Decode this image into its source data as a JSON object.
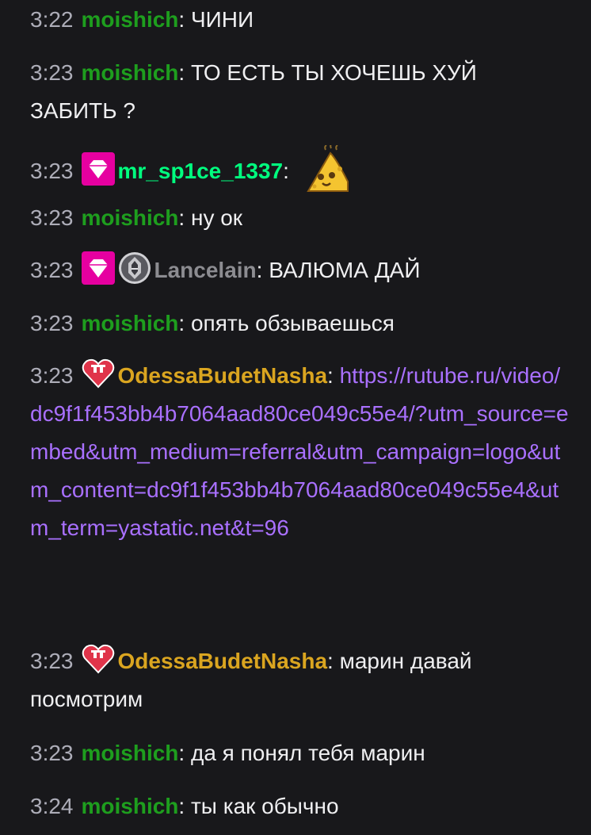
{
  "colors": {
    "background": "#18181b",
    "timestamp": "#adadb8",
    "text": "#efeff1",
    "link": "#a970ff",
    "moishich": "#1e9e1e",
    "mr_sp1ce": "#00ff7f",
    "lancelain": "#8c8c91",
    "odessa": "#daa520",
    "sub_badge": "#e600a0"
  },
  "messages": [
    {
      "time": "3:22",
      "user": "moishich",
      "text": "ЧИНИ"
    },
    {
      "time": "3:23",
      "user": "moishich",
      "text": "ТО ЕСТЬ ТЫ ХОЧЕШЬ ХУЙ ЗАБИТЬ ?"
    },
    {
      "time": "3:23",
      "user": "mr_sp1ce_1337",
      "badges": [
        "diamond-badge"
      ],
      "emote": "cheese-emote"
    },
    {
      "time": "3:23",
      "user": "moishich",
      "text": "ну ок"
    },
    {
      "time": "3:23",
      "user": "Lancelain",
      "badges": [
        "diamond-badge",
        "helmet-badge"
      ],
      "text": "ВАЛЮМА ДАЙ"
    },
    {
      "time": "3:23",
      "user": "moishich",
      "text": "опять обзываешься"
    },
    {
      "time": "3:23",
      "user": "OdessaBudetNasha",
      "badges": [
        "heart-badge"
      ],
      "text": "https://rutube.ru/video/dc9f1f453bb4b7064aad80ce049c55e4/?utm_source=embed&utm_medium=referral&utm_campaign=logo&utm_content=dc9f1f453bb4b7064aad80ce049c55e4&utm_term=yastatic.net&t=96"
    },
    {
      "time": "3:23",
      "user": "OdessaBudetNasha",
      "badges": [
        "heart-badge"
      ],
      "text": "марин давай посмотрим"
    },
    {
      "time": "3:23",
      "user": "moishich",
      "text": "да я понял тебя марин"
    },
    {
      "time": "3:24",
      "user": "moishich",
      "text": "ты как обычно"
    }
  ],
  "separator": ": "
}
